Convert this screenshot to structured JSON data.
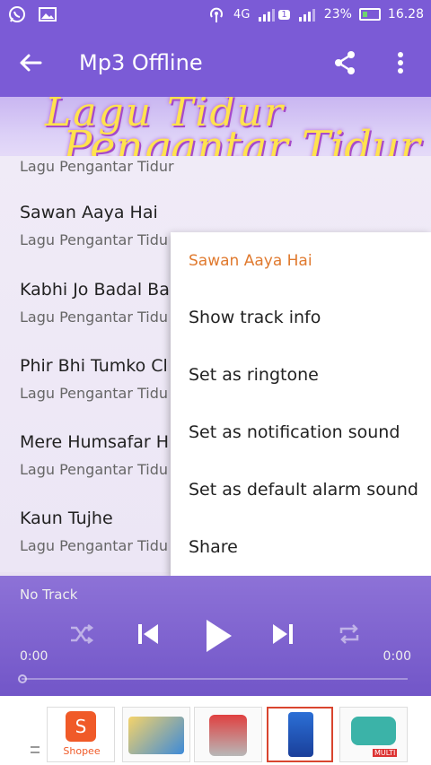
{
  "status_bar": {
    "network": "4G",
    "sim_badge": "1",
    "battery_percent": "23%",
    "time": "16.28"
  },
  "app_bar": {
    "title": "Mp3 Offline"
  },
  "tracks": [
    {
      "name": "",
      "artist": "Lagu Pengantar Tidur"
    },
    {
      "name": "Sawan Aaya Hai",
      "artist": "Lagu Pengantar Tidu"
    },
    {
      "name": "Kabhi Jo Badal Ba",
      "artist": "Lagu Pengantar Tidu"
    },
    {
      "name": "Phir Bhi Tumko Cl",
      "artist": "Lagu Pengantar Tidu"
    },
    {
      "name": "Mere Humsafar  H",
      "artist": "Lagu Pengantar Tidu"
    },
    {
      "name": "Kaun Tujhe",
      "artist": "Lagu Pengantar Tidu"
    }
  ],
  "context_menu": {
    "header": "Sawan Aaya Hai",
    "items": [
      "Show track info",
      "Set as ringtone",
      "Set as notification sound",
      "Set as default alarm sound",
      "Share"
    ]
  },
  "player": {
    "now_playing": "No Track",
    "time_elapsed": "0:00",
    "time_total": "0:00",
    "progress": 0
  },
  "ads": {
    "shopee_label": "Shopee",
    "ad5_label": "MULTI"
  },
  "colors": {
    "primary": "#7b5bd6",
    "menu_header": "#e07a2f",
    "shopee": "#f05a28"
  }
}
